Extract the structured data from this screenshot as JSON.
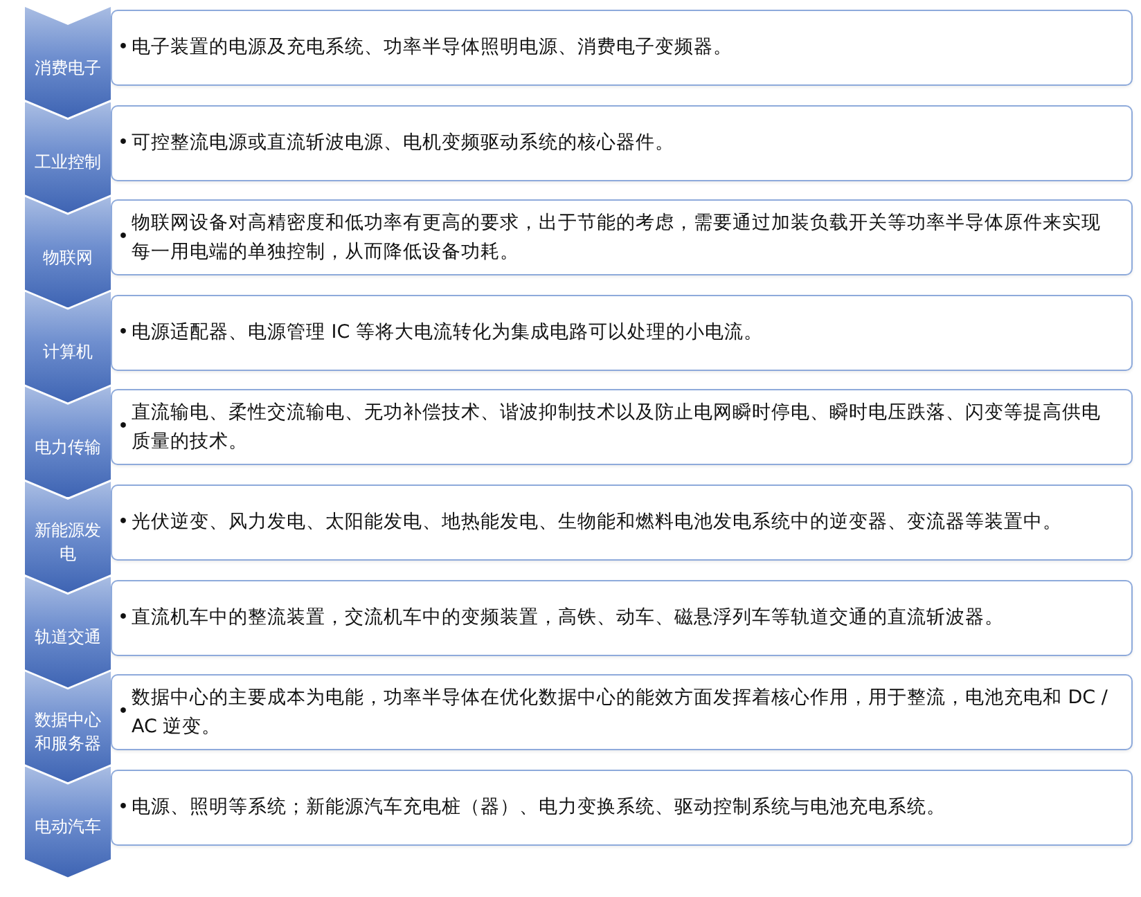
{
  "rows": [
    {
      "category": "消费电子",
      "bullet": "•",
      "text": "电子装置的电源及充电系统、功率半导体照明电源、消费电子变频器。"
    },
    {
      "category": "工业控制",
      "bullet": "•",
      "text": "可控整流电源或直流斩波电源、电机变频驱动系统的核心器件。"
    },
    {
      "category": "物联网",
      "bullet": "•",
      "text": "物联网设备对高精密度和低功率有更高的要求，出于节能的考虑，需要通过加装负载开关等功率半导体原件来实现每一用电端的单独控制，从而降低设备功耗。"
    },
    {
      "category": "计算机",
      "bullet": "•",
      "text": "电源适配器、电源管理 IC 等将大电流转化为集成电路可以处理的小电流。"
    },
    {
      "category": "电力传输",
      "bullet": "•",
      "text": "直流输电、柔性交流输电、无功补偿技术、谐波抑制技术以及防止电网瞬时停电、瞬时电压跌落、闪变等提高供电质量的技术。"
    },
    {
      "category": "新能源发电",
      "bullet": "•",
      "text": "光伏逆变、风力发电、太阳能发电、地热能发电、生物能和燃料电池发电系统中的逆变器、变流器等装置中。"
    },
    {
      "category": "轨道交通",
      "bullet": "•",
      "text": "直流机车中的整流装置，交流机车中的变频装置，高铁、动车、磁悬浮列车等轨道交通的直流斩波器。"
    },
    {
      "category": "数据中心和服务器",
      "bullet": "•",
      "text": "数据中心的主要成本为电能，功率半导体在优化数据中心的能效方面发挥着核心作用，用于整流，电池充电和 DC / AC 逆变。"
    },
    {
      "category": "电动汽车",
      "bullet": "•",
      "text": "电源、照明等系统；新能源汽车充电桩（器）、电力变换系统、驱动控制系统与电池充电系统。"
    }
  ]
}
